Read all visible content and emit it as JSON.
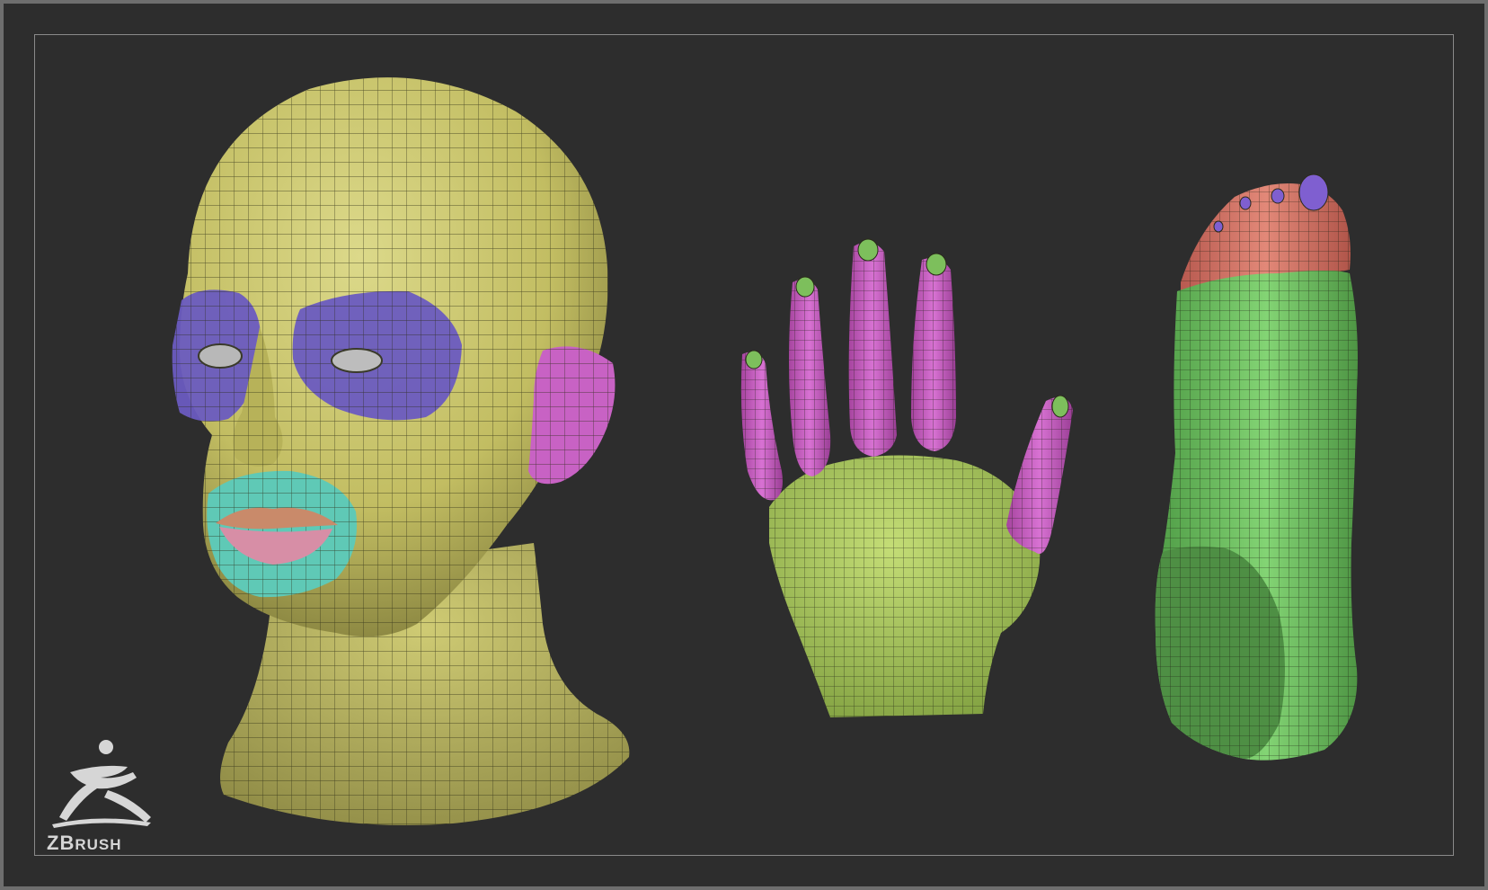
{
  "brand": {
    "logo_text_big": "ZB",
    "logo_text_small": "RUSH",
    "logo_icon": "zbrush-runner-logo-icon"
  },
  "models": [
    {
      "name": "head",
      "label": ""
    },
    {
      "name": "hand",
      "label": ""
    },
    {
      "name": "foot",
      "label": ""
    }
  ],
  "colors": {
    "background": "#2d2d2d",
    "frame": "#8a8a8a",
    "skin_yellow": "#c9c46a",
    "eye_purple": "#6a5bc0",
    "lip_cyan": "#5fc9b6",
    "lip_pink": "#d78ea6",
    "finger_magenta": "#c862c4",
    "hand_green": "#a9c85c",
    "foot_green": "#6fc464",
    "toe_salmon": "#d9786a",
    "nail_purple": "#7f5fd0"
  }
}
